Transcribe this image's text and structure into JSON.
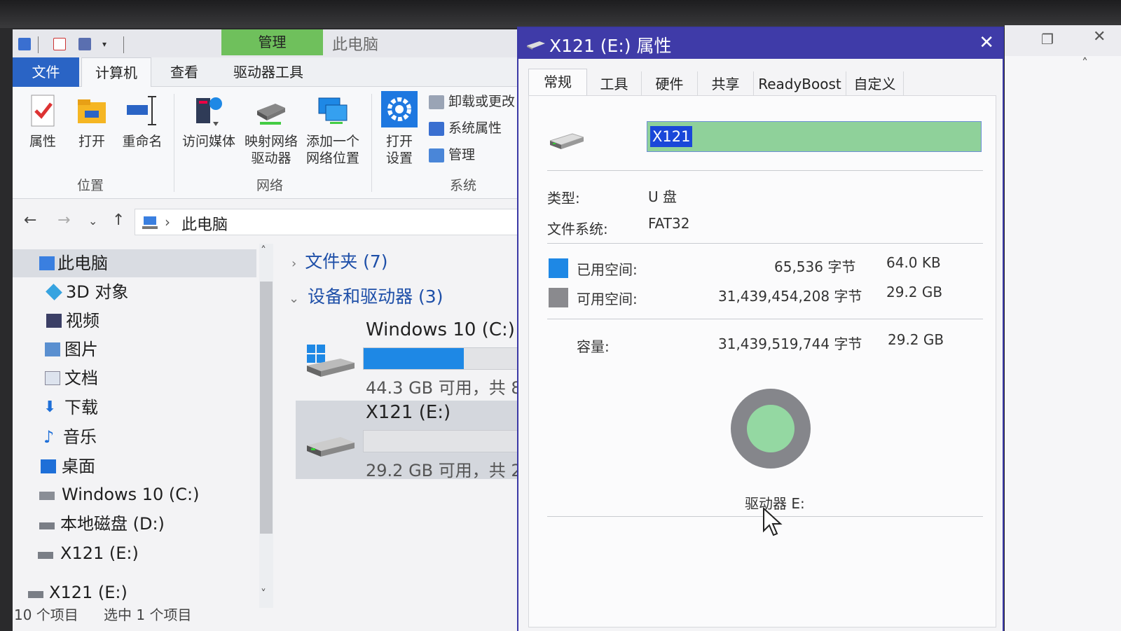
{
  "explorer": {
    "context_tab": "管理",
    "window_title": "此电脑",
    "ribbon_tabs": [
      "文件",
      "计算机",
      "查看",
      "驱动器工具"
    ],
    "groups": {
      "location": {
        "label": "位置",
        "buttons": [
          "属性",
          "打开",
          "重命名"
        ]
      },
      "network": {
        "label": "网络",
        "buttons": [
          {
            "line1": "访问媒体",
            "line2": ""
          },
          {
            "line1": "映射网络",
            "line2": "驱动器"
          },
          {
            "line1": "添加一个",
            "line2": "网络位置"
          }
        ]
      },
      "system": {
        "label": "系统",
        "open_settings_line1": "打开",
        "open_settings_line2": "设置",
        "small_buttons": [
          "卸载或更改",
          "系统属性",
          "管理"
        ]
      }
    },
    "nav": {
      "back": "←",
      "forward": "→",
      "recent": "⌄",
      "up": "↑"
    },
    "address": {
      "crumb": "此电脑"
    },
    "nav_pane": [
      {
        "label": "此电脑",
        "icon": "pc-icon"
      },
      {
        "label": "3D 对象",
        "icon": "3d-objects-icon"
      },
      {
        "label": "视频",
        "icon": "video-icon"
      },
      {
        "label": "图片",
        "icon": "pictures-icon"
      },
      {
        "label": "文档",
        "icon": "documents-icon"
      },
      {
        "label": "下载",
        "icon": "download-icon"
      },
      {
        "label": "音乐",
        "icon": "music-icon"
      },
      {
        "label": "桌面",
        "icon": "desktop-icon"
      },
      {
        "label": "Windows 10 (C:)",
        "icon": "drive-icon"
      },
      {
        "label": "本地磁盘 (D:)",
        "icon": "drive-icon"
      },
      {
        "label": "X121 (E:)",
        "icon": "usb-drive-icon"
      },
      {
        "label": "X121 (E:)",
        "icon": "usb-drive-icon"
      }
    ],
    "sections": {
      "folders": "文件夹 (7)",
      "devices": "设备和驱动器 (3)"
    },
    "drives": [
      {
        "name": "Windows 10 (C:)",
        "free": "44.3 GB 可用，共 8",
        "used_fraction": 0.48
      },
      {
        "name": "X121 (E:)",
        "free": "29.2 GB 可用，共 2",
        "used_fraction": 0.0
      }
    ],
    "status": {
      "items": "10 个项目",
      "selected": "选中 1 个项目"
    }
  },
  "dialog": {
    "title": "X121 (E:) 属性",
    "close": "✕",
    "tabs": [
      "常规",
      "工具",
      "硬件",
      "共享",
      "ReadyBoost",
      "自定义"
    ],
    "name_value": "X121",
    "type_label": "类型:",
    "type_value": "U 盘",
    "fs_label": "文件系统:",
    "fs_value": "FAT32",
    "used": {
      "label": "已用空间:",
      "bytes": "65,536 字节",
      "size": "64.0 KB",
      "color": "#1e88e5"
    },
    "free": {
      "label": "可用空间:",
      "bytes": "31,439,454,208 字节",
      "size": "29.2 GB",
      "color": "#8a8a8e"
    },
    "capacity": {
      "label": "容量:",
      "bytes": "31,439,519,744 字节",
      "size": "29.2 GB"
    },
    "drive_label": "驱动器 E:",
    "used_fraction": 2.1e-06
  },
  "colors": {
    "accent": "#2a64c5",
    "context_tab": "#6fc05c",
    "dialog_title": "#3f3ba8",
    "selection": "#1a47d9"
  }
}
